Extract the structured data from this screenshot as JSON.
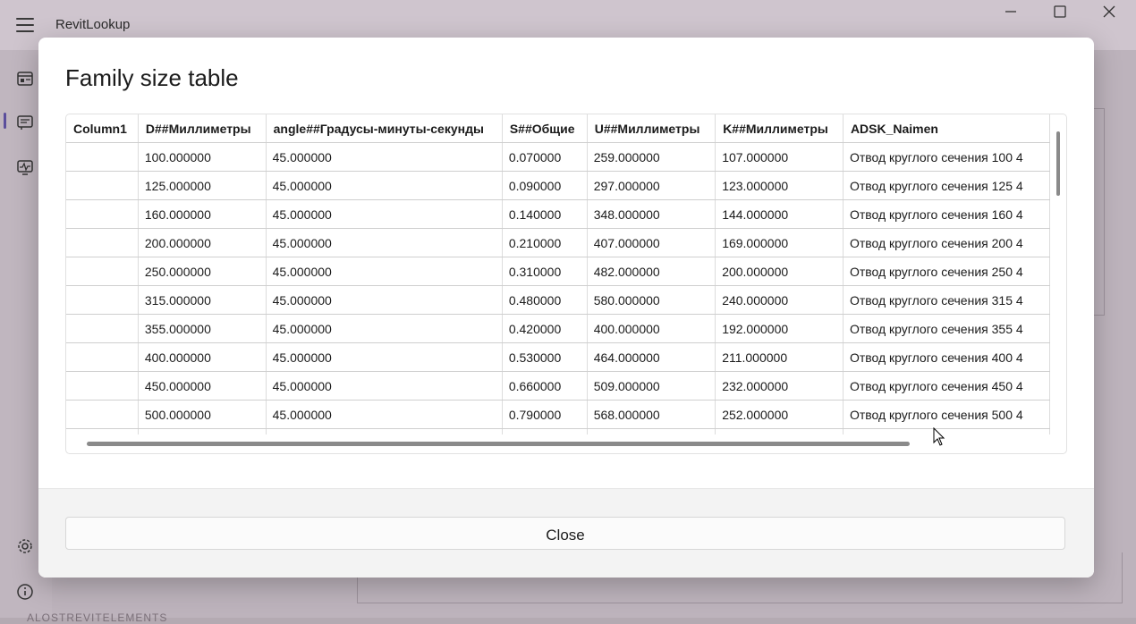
{
  "app": {
    "title": "RevitLookup",
    "background_footer": "ALOSTREVITELEMENTS"
  },
  "dialog": {
    "title": "Family size table",
    "close_label": "Close"
  },
  "table": {
    "columns": [
      "Column1",
      "D##Миллиметры",
      "angle##Градусы-минуты-секунды",
      "S##Общие",
      "U##Миллиметры",
      "K##Миллиметры",
      "ADSK_Naimen"
    ],
    "rows": [
      [
        "",
        "100.000000",
        "45.000000",
        "0.070000",
        "259.000000",
        "107.000000",
        "Отвод круглого сечения 100 4"
      ],
      [
        "",
        "125.000000",
        "45.000000",
        "0.090000",
        "297.000000",
        "123.000000",
        "Отвод круглого сечения 125 4"
      ],
      [
        "",
        "160.000000",
        "45.000000",
        "0.140000",
        "348.000000",
        "144.000000",
        "Отвод круглого сечения 160 4"
      ],
      [
        "",
        "200.000000",
        "45.000000",
        "0.210000",
        "407.000000",
        "169.000000",
        "Отвод круглого сечения 200 4"
      ],
      [
        "",
        "250.000000",
        "45.000000",
        "0.310000",
        "482.000000",
        "200.000000",
        "Отвод круглого сечения 250 4"
      ],
      [
        "",
        "315.000000",
        "45.000000",
        "0.480000",
        "580.000000",
        "240.000000",
        "Отвод круглого сечения 315 4"
      ],
      [
        "",
        "355.000000",
        "45.000000",
        "0.420000",
        "400.000000",
        "192.000000",
        "Отвод круглого сечения 355 4"
      ],
      [
        "",
        "400.000000",
        "45.000000",
        "0.530000",
        "464.000000",
        "211.000000",
        "Отвод круглого сечения 400 4"
      ],
      [
        "",
        "450.000000",
        "45.000000",
        "0.660000",
        "509.000000",
        "232.000000",
        "Отвод круглого сечения 450 4"
      ],
      [
        "",
        "500.000000",
        "45.000000",
        "0.790000",
        "568.000000",
        "252.000000",
        "Отвод круглого сечения 500 4"
      ],
      [
        "",
        "",
        "",
        "",
        "",
        "",
        ""
      ]
    ]
  },
  "icons": {
    "menu": "hamburger-icon",
    "dashboard": "dashboard-icon",
    "snoop": "snoop-icon",
    "events": "events-monitor-icon",
    "settings": "gear-icon",
    "about": "info-icon",
    "minimize": "minimize-icon",
    "maximize": "maximize-icon",
    "close": "close-icon"
  },
  "colors": {
    "accent": "#5b4e9c",
    "overlay": "#b4aab2",
    "dialog_bg": "#ffffff",
    "footer_bg": "#f3f3f3"
  }
}
